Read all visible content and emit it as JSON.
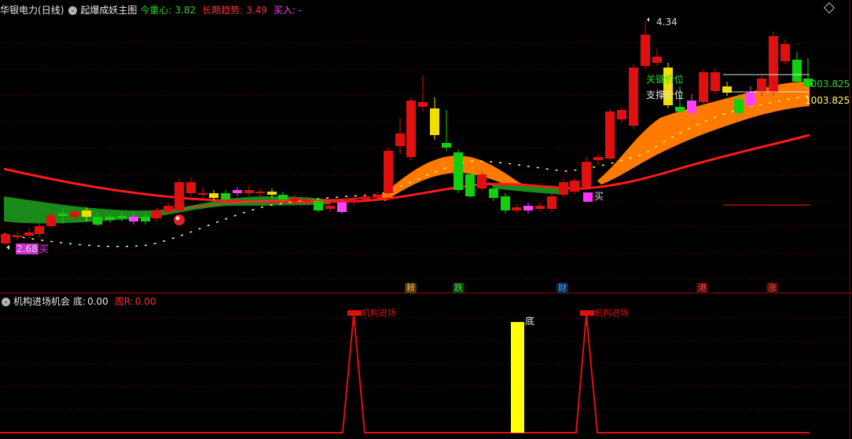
{
  "main_panel": {
    "stock_name": "华银电力",
    "period": "(日线)",
    "indicator_name": "起爆成妖主图",
    "center_label": "今重心:",
    "center_value": "3.82",
    "trend_label": "长期趋势:",
    "trend_value": "3.49",
    "buy_label": "买入:",
    "buy_value": "-",
    "high_marker": "4.34",
    "low_marker": "2.68",
    "low_buy_label": "买",
    "mid_buy_label": "买",
    "key_price_label": "关键价位",
    "key_price_value": "1003.825",
    "support_label": "支撑价位",
    "support_value": "1003.825",
    "bottom_tags": [
      {
        "text": "耪",
        "color": "#e8b070"
      },
      {
        "text": "跌",
        "color": "#40e040"
      },
      {
        "text": "财",
        "color": "#4aa0ff"
      },
      {
        "text": "港",
        "color": "#ff4040"
      },
      {
        "text": "涨",
        "color": "#ff4040"
      }
    ]
  },
  "sub_panel": {
    "title": "机构进场机会",
    "bottom_label": "底:",
    "bottom_value": "0.00",
    "weekly_label": "周R:",
    "weekly_value": "0.00",
    "entry_label_1": "机构进场",
    "entry_label_2": "机构进场",
    "bottom_marker": "底"
  },
  "colors": {
    "up": "#e01010",
    "down": "#10d010",
    "trend": "#ff1a1a",
    "band_orange": "#ff7a00",
    "band_green": "#1a8a1a",
    "header_green": "#26d626",
    "header_red": "#ff3030",
    "header_magenta": "#ff40ff",
    "yellow": "#ffff00"
  }
}
